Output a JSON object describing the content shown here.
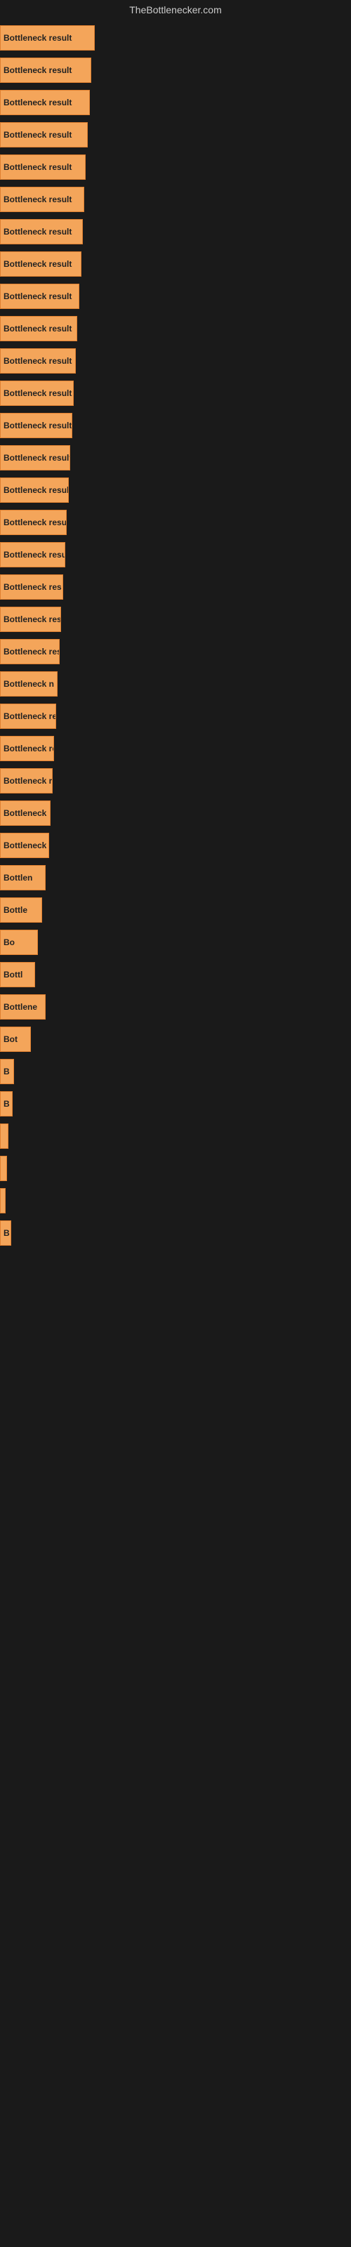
{
  "site": {
    "title": "TheBottlenecker.com"
  },
  "bars": [
    {
      "label": "Bottleneck result",
      "width": 135
    },
    {
      "label": "Bottleneck result",
      "width": 130
    },
    {
      "label": "Bottleneck result",
      "width": 128
    },
    {
      "label": "Bottleneck result",
      "width": 125
    },
    {
      "label": "Bottleneck result",
      "width": 122
    },
    {
      "label": "Bottleneck result",
      "width": 120
    },
    {
      "label": "Bottleneck result",
      "width": 118
    },
    {
      "label": "Bottleneck result",
      "width": 116
    },
    {
      "label": "Bottleneck result",
      "width": 113
    },
    {
      "label": "Bottleneck result",
      "width": 110
    },
    {
      "label": "Bottleneck result",
      "width": 108
    },
    {
      "label": "Bottleneck result",
      "width": 105
    },
    {
      "label": "Bottleneck result",
      "width": 103
    },
    {
      "label": "Bottleneck result",
      "width": 100
    },
    {
      "label": "Bottleneck result",
      "width": 98
    },
    {
      "label": "Bottleneck result",
      "width": 95
    },
    {
      "label": "Bottleneck result",
      "width": 93
    },
    {
      "label": "Bottleneck res",
      "width": 90
    },
    {
      "label": "Bottleneck result",
      "width": 87
    },
    {
      "label": "Bottleneck res",
      "width": 85
    },
    {
      "label": "Bottleneck n",
      "width": 82
    },
    {
      "label": "Bottleneck res",
      "width": 80
    },
    {
      "label": "Bottleneck re",
      "width": 77
    },
    {
      "label": "Bottleneck result",
      "width": 75
    },
    {
      "label": "Bottleneck",
      "width": 72
    },
    {
      "label": "Bottleneck res",
      "width": 70
    },
    {
      "label": "Bottlen",
      "width": 65
    },
    {
      "label": "Bottle",
      "width": 60
    },
    {
      "label": "Bo",
      "width": 54
    },
    {
      "label": "Bottl",
      "width": 50
    },
    {
      "label": "Bottlene",
      "width": 65
    },
    {
      "label": "Bot",
      "width": 44
    },
    {
      "label": "B",
      "width": 20
    },
    {
      "label": "B",
      "width": 18
    },
    {
      "label": "",
      "width": 12
    },
    {
      "label": "",
      "width": 10
    },
    {
      "label": "",
      "width": 8
    },
    {
      "label": "B",
      "width": 16
    }
  ]
}
